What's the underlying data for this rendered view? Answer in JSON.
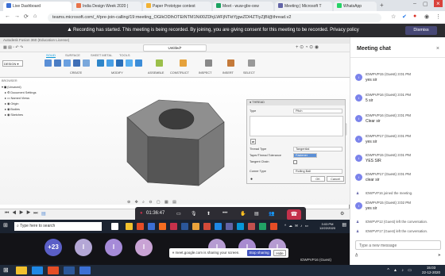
{
  "browser": {
    "tabs": [
      {
        "label": "Live Dashboard",
        "color": "#3b6fd4"
      },
      {
        "label": "India Design Week 2020 |",
        "color": "#e8734a"
      },
      {
        "label": "Paper Prototype contest",
        "color": "#f2b233"
      },
      {
        "label": "Meet - wuw-gbv-oxw",
        "color": "#1aa260"
      },
      {
        "label": "Meeting | Microsoft T",
        "color": "#6264a7"
      },
      {
        "label": "WhatsApp",
        "color": "#25d366"
      }
    ],
    "url": "teams.microsoft.com/_#/pre-join-calling/19:meeting_OGIkODlhOTEtNTM1Ni00ZDhjLWFjNTktYjgwZDI4ZTIyZjBl@thread.v2",
    "banner": "Recording has started. This meeting is being recorded. By joining, you are giving consent for this meeting to be recorded. Privacy policy",
    "dismiss": "Dismiss"
  },
  "app": {
    "title": "Autodesk Fusion 360 (Education License)",
    "doc_tab": "Untitled*",
    "workspace": "DESIGN",
    "ribbon_tabs": [
      "SOLID",
      "SURFACE",
      "SHEET METAL",
      "TOOLS"
    ],
    "ribbon_groups": [
      "CREATE",
      "MODIFY",
      "ASSEMBLE",
      "CONSTRUCT",
      "INSPECT",
      "INSERT",
      "SELECT"
    ],
    "browser_title": "BROWSER",
    "browser_items": [
      "(Unsaved)",
      "Document Settings",
      "Named Views",
      "Origin",
      "Bodies",
      "Sketches"
    ],
    "panel": {
      "title": "THREAD",
      "fields": [
        {
          "label": "Type",
          "value": "Pitch"
        },
        {
          "label": "Thread Type",
          "value": "Tangential"
        },
        {
          "label": "Taper/Thread Tolerance",
          "value": "Fastener"
        },
        {
          "label": "Tangent Chain",
          "value": ""
        },
        {
          "label": "Corner Type",
          "value": "Rolling Ball"
        }
      ],
      "ok": "OK",
      "cancel": "Cancel"
    },
    "nav_icons": "⊕ ✥ ⌕ ⊖ ▢ ▦ ▤"
  },
  "meeting": {
    "timer": "01:36:47",
    "share_text": "meet.google.com is sharing your screen.",
    "stop_sharing": "Stop sharing",
    "hide": "Hide",
    "participants": [
      {
        "label": "+23",
        "color": "#5b5fc7"
      },
      {
        "label": "I",
        "color": "#b4a7d6"
      },
      {
        "label": "I",
        "color": "#a68bd8"
      },
      {
        "label": "I",
        "color": "#c9a3d5"
      },
      {
        "label": "I",
        "color": "#b69cd2"
      },
      {
        "label": "I",
        "color": "#a88bd0"
      },
      {
        "label": "I",
        "color": "#b59bd1"
      }
    ],
    "guest_name": "IDWPVP16 (Guest)"
  },
  "inner_taskbar": {
    "search": "Type here to search",
    "time": "3:03 PM",
    "date": "12/22/2020"
  },
  "chat": {
    "title": "Meeting chat",
    "messages": [
      {
        "name": "IDWPVP15 (Guest)",
        "time": "3:01 PM",
        "text": "yes sir"
      },
      {
        "name": "IDWPVP16 (Guest)",
        "time": "3:01 PM",
        "text": "5 sir"
      },
      {
        "name": "IDWPVP16 (Guest)",
        "time": "3:01 PM",
        "text": "Clear sir"
      },
      {
        "name": "IDWPVP17 (Guest)",
        "time": "3:01 PM",
        "text": "yes sir"
      },
      {
        "name": "IDWPVP15 (Guest)",
        "time": "3:01 PM",
        "text": "YES SIR"
      },
      {
        "name": "IDWPVP17 (Guest)",
        "time": "3:01 PM",
        "text": "clear sir"
      }
    ],
    "system": [
      "IDWPVP16 joined the meeting.",
      "IDWPVP12 (Guest) left the conversation.",
      "IDWPVP17 (Guest) left the conversation."
    ],
    "late_message": {
      "name": "IDWPVP15 (Guest)",
      "time": "3:02 PM",
      "text": "yes sir"
    },
    "input_placeholder": "Type a new message"
  },
  "os_taskbar": {
    "time": "15:03",
    "date": "22-12-2020"
  }
}
